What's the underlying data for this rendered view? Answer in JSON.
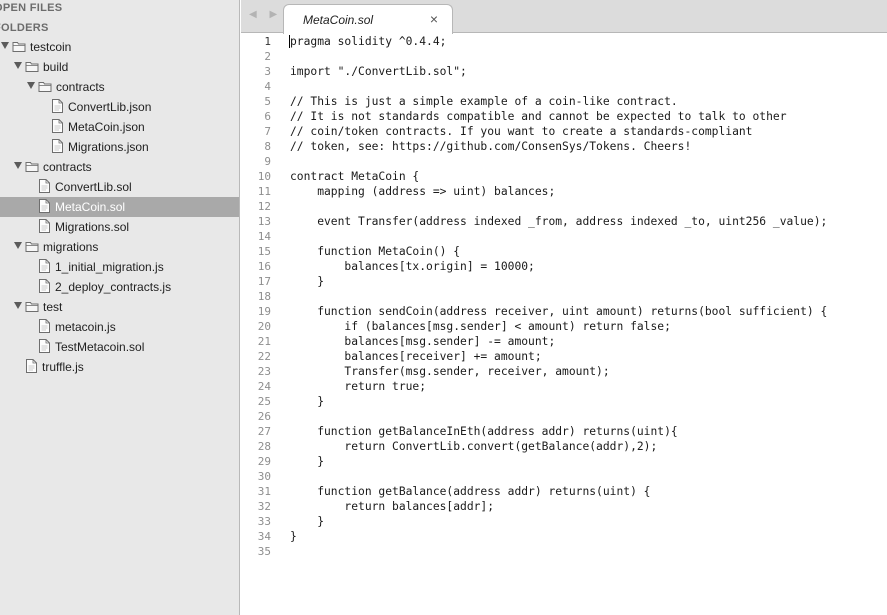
{
  "sidebar": {
    "open_files_header": "OPEN FILES",
    "folders_header": "FOLDERS",
    "tree": [
      {
        "label": "testcoin",
        "type": "folder",
        "depth": 0
      },
      {
        "label": "build",
        "type": "folder",
        "depth": 1
      },
      {
        "label": "contracts",
        "type": "folder",
        "depth": 2
      },
      {
        "label": "ConvertLib.json",
        "type": "file",
        "depth": 3
      },
      {
        "label": "MetaCoin.json",
        "type": "file",
        "depth": 3
      },
      {
        "label": "Migrations.json",
        "type": "file",
        "depth": 3
      },
      {
        "label": "contracts",
        "type": "folder",
        "depth": 1
      },
      {
        "label": "ConvertLib.sol",
        "type": "file",
        "depth": 2
      },
      {
        "label": "MetaCoin.sol",
        "type": "file",
        "depth": 2,
        "selected": true
      },
      {
        "label": "Migrations.sol",
        "type": "file",
        "depth": 2
      },
      {
        "label": "migrations",
        "type": "folder",
        "depth": 1
      },
      {
        "label": "1_initial_migration.js",
        "type": "file",
        "depth": 2
      },
      {
        "label": "2_deploy_contracts.js",
        "type": "file",
        "depth": 2
      },
      {
        "label": "test",
        "type": "folder",
        "depth": 1
      },
      {
        "label": "metacoin.js",
        "type": "file",
        "depth": 2
      },
      {
        "label": "TestMetacoin.sol",
        "type": "file",
        "depth": 2
      },
      {
        "label": "truffle.js",
        "type": "file",
        "depth": 1
      }
    ]
  },
  "tabbar": {
    "nav_arrows": "◀ ▶",
    "active_tab": {
      "title": "MetaCoin.sol",
      "close": "×"
    }
  },
  "editor": {
    "current_line": 1,
    "lines": [
      "pragma solidity ^0.4.4;",
      "",
      "import \"./ConvertLib.sol\";",
      "",
      "// This is just a simple example of a coin-like contract.",
      "// It is not standards compatible and cannot be expected to talk to other",
      "// coin/token contracts. If you want to create a standards-compliant",
      "// token, see: https://github.com/ConsenSys/Tokens. Cheers!",
      "",
      "contract MetaCoin {",
      "    mapping (address => uint) balances;",
      "",
      "    event Transfer(address indexed _from, address indexed _to, uint256 _value);",
      "",
      "    function MetaCoin() {",
      "        balances[tx.origin] = 10000;",
      "    }",
      "",
      "    function sendCoin(address receiver, uint amount) returns(bool sufficient) {",
      "        if (balances[msg.sender] < amount) return false;",
      "        balances[msg.sender] -= amount;",
      "        balances[receiver] += amount;",
      "        Transfer(msg.sender, receiver, amount);",
      "        return true;",
      "    }",
      "",
      "    function getBalanceInEth(address addr) returns(uint){",
      "        return ConvertLib.convert(getBalance(addr),2);",
      "    }",
      "",
      "    function getBalance(address addr) returns(uint) {",
      "        return balances[addr];",
      "    }",
      "}",
      ""
    ]
  }
}
